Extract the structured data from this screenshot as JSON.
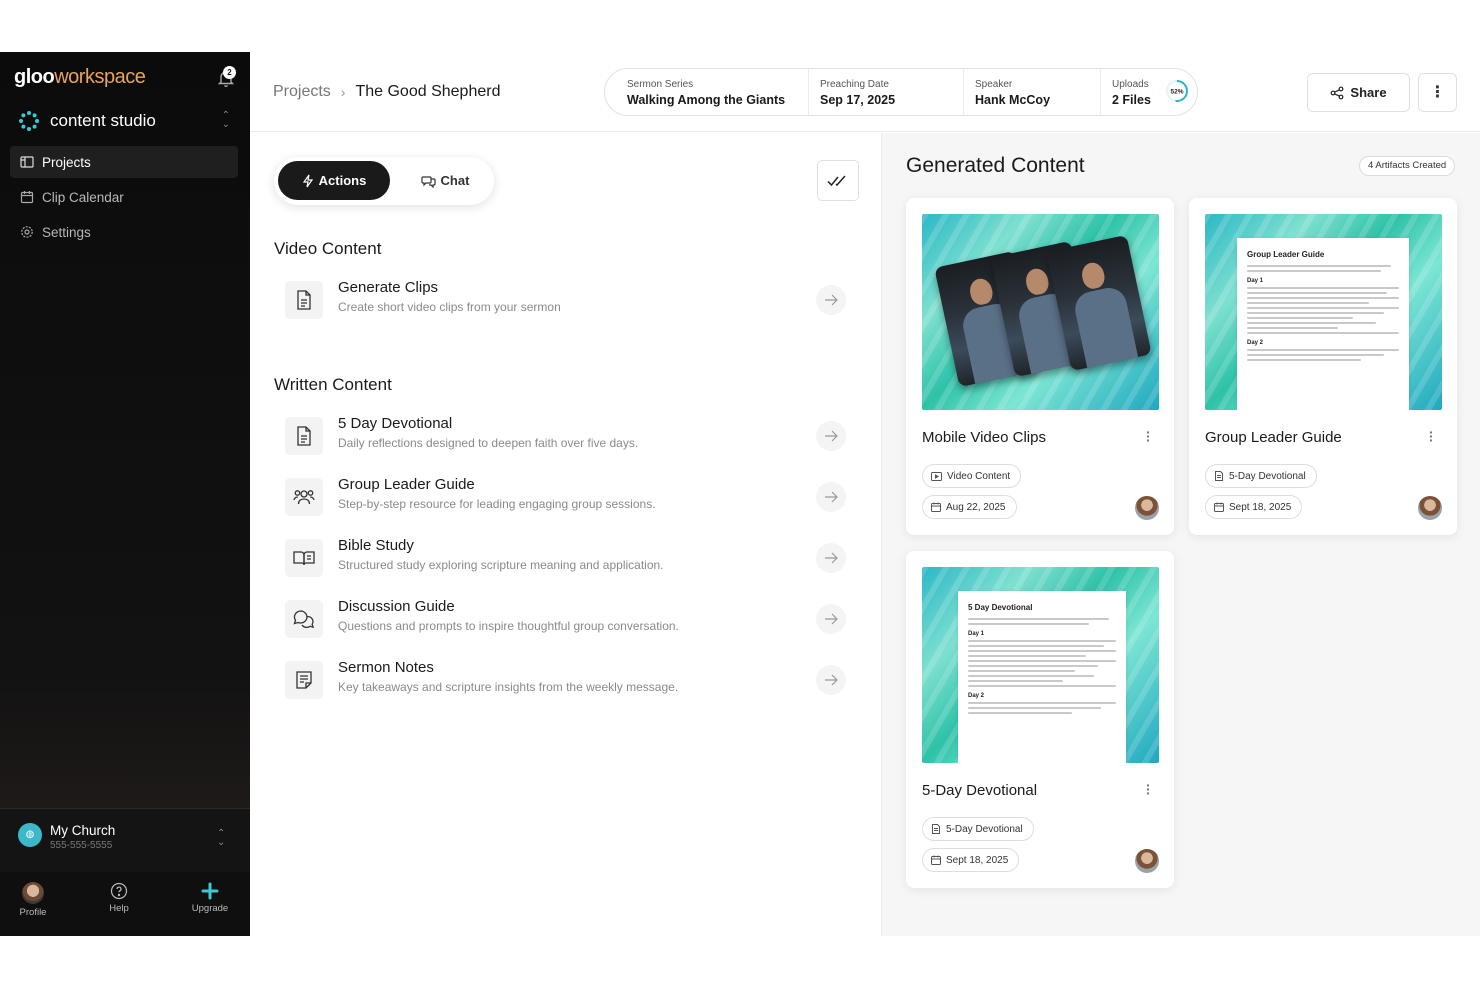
{
  "sidebar": {
    "logo_primary": "gloo",
    "logo_secondary": "workspace",
    "notification_count": "2",
    "studio_label": "content studio",
    "nav": [
      {
        "label": "Projects",
        "icon": "projects-icon",
        "active": true
      },
      {
        "label": "Clip Calendar",
        "icon": "calendar-icon",
        "active": false
      },
      {
        "label": "Settings",
        "icon": "gear-icon",
        "active": false
      }
    ],
    "church": {
      "name": "My Church",
      "phone": "555-555-5555"
    },
    "bottom": [
      {
        "label": "Profile",
        "icon": "profile-avatar"
      },
      {
        "label": "Help",
        "icon": "help-icon"
      },
      {
        "label": "Upgrade",
        "icon": "plus-icon"
      }
    ]
  },
  "header": {
    "breadcrumb": [
      "Projects",
      "The Good Shepherd"
    ],
    "meta": [
      {
        "key": "Sermon Series",
        "value": "Walking Among the Giants"
      },
      {
        "key": "Preaching Date",
        "value": "Sep 17, 2025"
      },
      {
        "key": "Speaker",
        "value": "Hank McCoy"
      },
      {
        "key": "Uploads",
        "value": "2 Files"
      }
    ],
    "upload_progress_label": "52%",
    "upload_progress": 0.52,
    "share_label": "Share"
  },
  "actions_panel": {
    "tabs": {
      "actions": "Actions",
      "chat": "Chat"
    },
    "video_heading": "Video Content",
    "video_items": [
      {
        "title": "Generate Clips",
        "desc": "Create short video clips from your sermon",
        "icon": "document-icon"
      }
    ],
    "written_heading": "Written Content",
    "written_items": [
      {
        "title": "5 Day Devotional",
        "desc": "Daily reflections designed to deepen faith over five days.",
        "icon": "document-icon"
      },
      {
        "title": "Group Leader Guide",
        "desc": "Step-by-step resource for leading engaging group sessions.",
        "icon": "group-icon"
      },
      {
        "title": "Bible Study",
        "desc": "Structured study exploring scripture meaning and application.",
        "icon": "open-book-icon"
      },
      {
        "title": "Discussion Guide",
        "desc": "Questions and prompts to inspire thoughtful group conversation.",
        "icon": "chat-bubbles-icon"
      },
      {
        "title": "Sermon Notes",
        "desc": "Key takeaways and scripture insights from the weekly message.",
        "icon": "notes-icon"
      }
    ]
  },
  "generated": {
    "heading": "Generated Content",
    "count_label": "4 Artifacts Created",
    "cards": [
      {
        "title": "Mobile Video Clips",
        "tag": "Video Content",
        "date": "Aug 22, 2025"
      },
      {
        "title": "Group Leader Guide",
        "tag": "5-Day Devotional",
        "date": "Sept 18, 2025",
        "doc_title": "Group Leader Guide",
        "doc_day1": "Day 1",
        "doc_day2": "Day 2"
      },
      {
        "title": "5-Day Devotional",
        "tag": "5-Day Devotional",
        "date": "Sept 18, 2025",
        "doc_title": "5 Day Devotional",
        "doc_day1": "Day 1",
        "doc_day2": "Day 2"
      }
    ]
  },
  "colors": {
    "brand_accent": "#e8a35c",
    "sidebar_bg": "#0b0b0b",
    "teal": "#2bb8c6",
    "primary_dark": "#1a1a1a"
  }
}
